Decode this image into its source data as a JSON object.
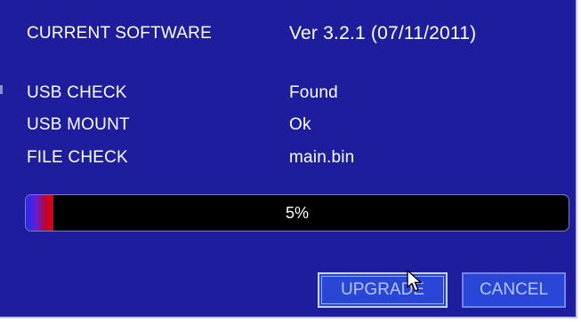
{
  "info": {
    "rows": [
      {
        "label": "CURRENT SOFTWARE",
        "value": "Ver 3.2.1 (07/11/2011)"
      },
      {
        "label": "USB CHECK",
        "value": "Found"
      },
      {
        "label": "USB MOUNT",
        "value": "Ok"
      },
      {
        "label": "FILE CHECK",
        "value": "main.bin"
      }
    ]
  },
  "progress": {
    "fraction": 0.05,
    "label": "5%"
  },
  "buttons": {
    "upgrade": "UPGRADE",
    "cancel": "CANCEL"
  },
  "colors": {
    "panel_bg": "#1d1d9e",
    "text": "#ffffff",
    "button_bg": "#2a46d6",
    "button_text": "#b6c6ff",
    "progress_track": "#000000",
    "progress_fill_start": "#1e2cff",
    "progress_fill_end": "#e0001a"
  },
  "icons": {
    "pointer": "mouse-pointer-icon"
  }
}
